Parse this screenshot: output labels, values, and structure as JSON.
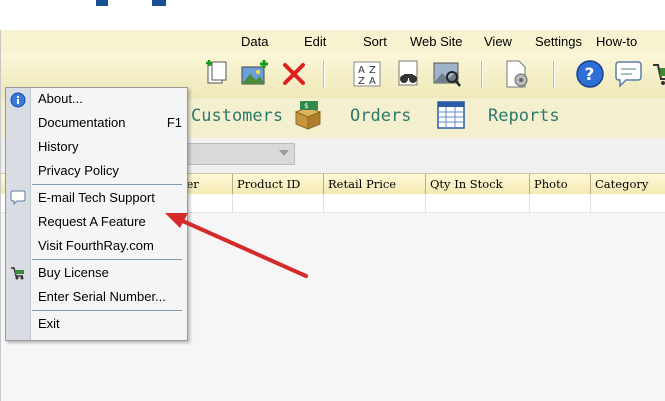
{
  "menubar": {
    "items": [
      "Data",
      "Edit",
      "Sort",
      "Web Site",
      "View",
      "Settings",
      "How-to"
    ]
  },
  "nav": {
    "customers": "Customers",
    "orders": "Orders",
    "reports": "Reports"
  },
  "grid": {
    "columns": [
      "rer",
      "Product ID",
      "Retail Price",
      "Qty In Stock",
      "Photo",
      "Category"
    ]
  },
  "help_menu": {
    "items": [
      {
        "label": "About...",
        "shortcut": ""
      },
      {
        "label": "Documentation",
        "shortcut": "F1"
      },
      {
        "label": "History",
        "shortcut": ""
      },
      {
        "label": "Privacy Policy",
        "shortcut": ""
      },
      {
        "label": "E-mail Tech Support",
        "shortcut": ""
      },
      {
        "label": "Request A Feature",
        "shortcut": ""
      },
      {
        "label": "Visit FourthRay.com",
        "shortcut": ""
      },
      {
        "label": "Buy License",
        "shortcut": ""
      },
      {
        "label": "Enter Serial Number...",
        "shortcut": ""
      },
      {
        "label": "Exit",
        "shortcut": ""
      }
    ]
  },
  "colors": {
    "accent_arrow": "#d42a2a",
    "nav_text": "#2c7a6a",
    "menubar_bg": "#f7f2d0"
  },
  "icons": [
    "info-icon",
    "chat-bubble-icon",
    "cart-icon",
    "new-record-icon",
    "image-add-icon",
    "delete-x-icon",
    "sort-az-icon",
    "find-icon",
    "image-search-icon",
    "print-preview-icon",
    "help-icon",
    "message-icon",
    "shopping-cart-icon"
  ]
}
